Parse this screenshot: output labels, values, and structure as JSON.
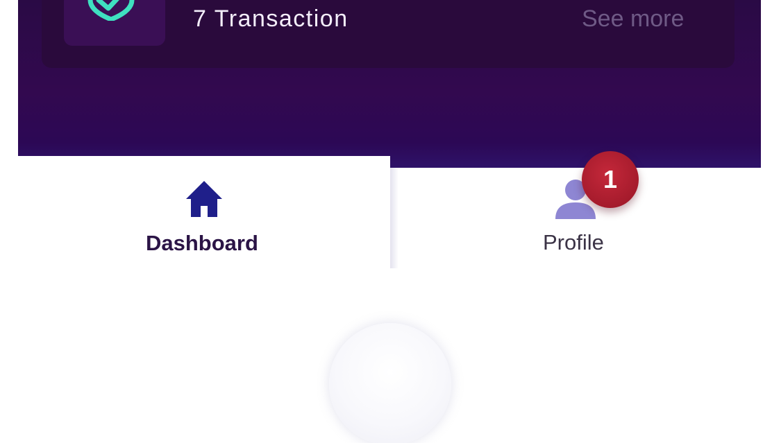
{
  "card": {
    "icon": "shield-check-icon",
    "transaction_count": "7 Transaction",
    "see_more": "See more"
  },
  "nav": {
    "dashboard": {
      "label": "Dashboard",
      "icon": "home-icon",
      "active": true
    },
    "profile": {
      "label": "Profile",
      "icon": "user-icon",
      "badge": "1"
    }
  },
  "home_button": {
    "icon": "home-circle-button"
  },
  "colors": {
    "header_bg": "#32094f",
    "card_bg": "#2a0a3c",
    "accent_teal": "#3fe0c0",
    "dashboard_icon": "#1f1f8a",
    "profile_icon": "#8e86d3",
    "badge_bg": "#a51b2c"
  }
}
